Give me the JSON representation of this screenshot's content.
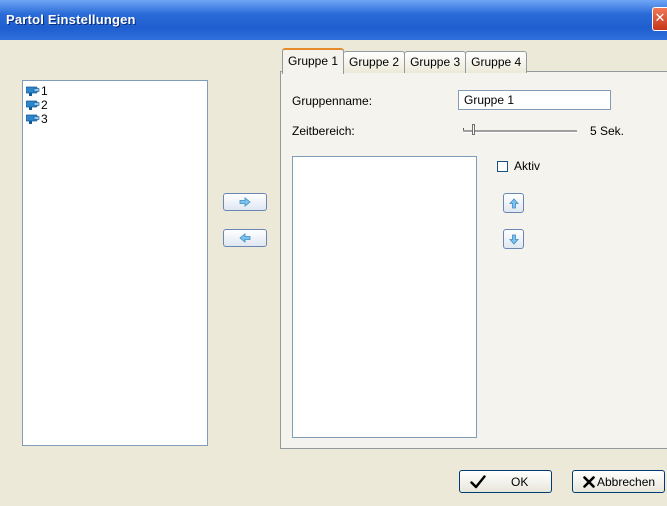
{
  "window": {
    "title": "Partol Einstellungen",
    "close_glyph": "✕"
  },
  "cameras": [
    {
      "label": "1"
    },
    {
      "label": "2"
    },
    {
      "label": "3"
    }
  ],
  "tabs": [
    {
      "label": "Gruppe 1"
    },
    {
      "label": "Gruppe 2"
    },
    {
      "label": "Gruppe 3"
    },
    {
      "label": "Gruppe 4"
    }
  ],
  "group": {
    "name_label": "Gruppenname:",
    "name_value": "Gruppe 1",
    "time_label": "Zeitbereich:",
    "time_value": "5 Sek.",
    "active_label": "Aktiv",
    "active_checked": false
  },
  "buttons": {
    "ok": "OK",
    "cancel": "Abbrechen"
  },
  "icons": {
    "camera": "camera-icon",
    "move_right": "arrow-right-icon",
    "move_left": "arrow-left-icon",
    "move_up": "arrow-up-icon",
    "move_down": "arrow-down-icon",
    "ok": "checkmark-icon",
    "cancel": "x-icon"
  },
  "colors": {
    "titlebar": "#2a6bd8",
    "window_bg": "#ece9d8",
    "tab_highlight": "#e68b2c",
    "icon_blue": "#2e86c8"
  }
}
